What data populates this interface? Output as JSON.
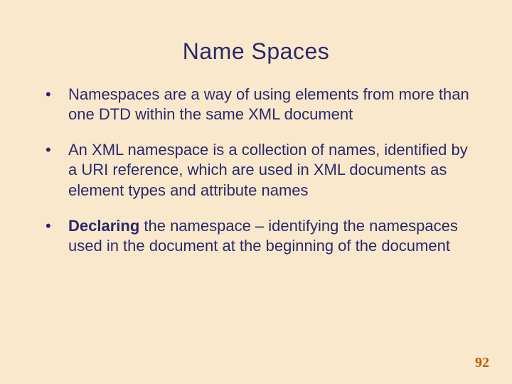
{
  "slide": {
    "title": "Name Spaces",
    "bullets": [
      {
        "text": "Namespaces are a way of using elements from more than one DTD within the same XML document"
      },
      {
        "text": "An XML namespace is a collection of names, identified by a URI reference, which are used in XML documents as element types and attribute names"
      },
      {
        "bold_lead": "Declaring",
        "text": " the namespace – identifying the namespaces used in the document at the beginning of the document"
      }
    ],
    "page_number": "92"
  }
}
